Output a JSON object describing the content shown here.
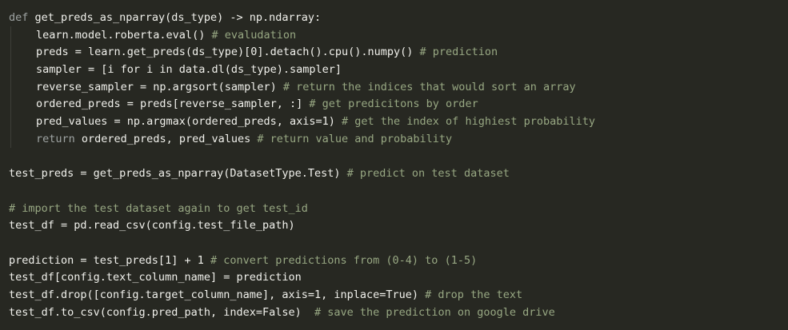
{
  "editor": {
    "colors": {
      "background": "#272822",
      "text": "#f1f1ec",
      "comment": "#98a883",
      "keyword": "#9fa4a3"
    },
    "lines": [
      {
        "indent": false,
        "segments": [
          {
            "kind": "kw",
            "text": "def"
          },
          {
            "kind": "code",
            "text": " get_preds_as_nparray(ds_type) -> np.ndarray:"
          }
        ]
      },
      {
        "indent": true,
        "segments": [
          {
            "kind": "code",
            "text": "learn.model.roberta.eval() "
          },
          {
            "kind": "cm",
            "text": "# evaludation"
          }
        ]
      },
      {
        "indent": true,
        "segments": [
          {
            "kind": "code",
            "text": "preds = learn.get_preds(ds_type)[0].detach().cpu().numpy() "
          },
          {
            "kind": "cm",
            "text": "# prediction"
          }
        ]
      },
      {
        "indent": true,
        "segments": [
          {
            "kind": "code",
            "text": "sampler = [i for i in data.dl(ds_type).sampler]"
          }
        ]
      },
      {
        "indent": true,
        "segments": [
          {
            "kind": "code",
            "text": "reverse_sampler = np.argsort(sampler) "
          },
          {
            "kind": "cm",
            "text": "# return the indices that would sort an array"
          }
        ]
      },
      {
        "indent": true,
        "segments": [
          {
            "kind": "code",
            "text": "ordered_preds = preds[reverse_sampler, :] "
          },
          {
            "kind": "cm",
            "text": "# get predicitons by order"
          }
        ]
      },
      {
        "indent": true,
        "segments": [
          {
            "kind": "code",
            "text": "pred_values = np.argmax(ordered_preds, axis=1) "
          },
          {
            "kind": "cm",
            "text": "# get the index of highiest probability"
          }
        ]
      },
      {
        "indent": true,
        "segments": [
          {
            "kind": "kw",
            "text": "return"
          },
          {
            "kind": "code",
            "text": " ordered_preds, pred_values "
          },
          {
            "kind": "cm",
            "text": "# return value and probability"
          }
        ]
      },
      {
        "indent": false,
        "segments": []
      },
      {
        "indent": false,
        "segments": [
          {
            "kind": "code",
            "text": "test_preds = get_preds_as_nparray(DatasetType.Test) "
          },
          {
            "kind": "cm",
            "text": "# predict on test dataset"
          }
        ]
      },
      {
        "indent": false,
        "segments": []
      },
      {
        "indent": false,
        "segments": [
          {
            "kind": "cm",
            "text": "# import the test dataset again to get test_id"
          }
        ]
      },
      {
        "indent": false,
        "segments": [
          {
            "kind": "code",
            "text": "test_df = pd.read_csv(config.test_file_path)"
          }
        ]
      },
      {
        "indent": false,
        "segments": []
      },
      {
        "indent": false,
        "segments": [
          {
            "kind": "code",
            "text": "prediction = test_preds[1] + 1 "
          },
          {
            "kind": "cm",
            "text": "# convert predictions from (0-4) to (1-5)"
          }
        ]
      },
      {
        "indent": false,
        "segments": [
          {
            "kind": "code",
            "text": "test_df[config.text_column_name] = prediction"
          }
        ]
      },
      {
        "indent": false,
        "segments": [
          {
            "kind": "code",
            "text": "test_df.drop([config.target_column_name], axis=1, inplace=True) "
          },
          {
            "kind": "cm",
            "text": "# drop the text"
          }
        ]
      },
      {
        "indent": false,
        "segments": [
          {
            "kind": "code",
            "text": "test_df.to_csv(config.pred_path, index=False)  "
          },
          {
            "kind": "cm",
            "text": "# save the prediction on google drive"
          }
        ]
      }
    ]
  }
}
